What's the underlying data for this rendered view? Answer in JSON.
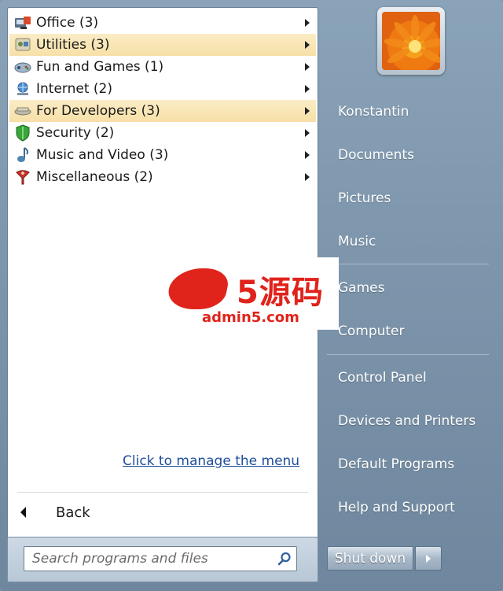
{
  "menu": {
    "items": [
      {
        "label": "Office (3)",
        "icon": "office-icon",
        "highlight": false
      },
      {
        "label": "Utilities (3)",
        "icon": "utilities-icon",
        "highlight": true
      },
      {
        "label": "Fun and Games (1)",
        "icon": "games-controller-icon",
        "highlight": false
      },
      {
        "label": "Internet (2)",
        "icon": "internet-icon",
        "highlight": false
      },
      {
        "label": "For Developers (3)",
        "icon": "developer-icon",
        "highlight": true
      },
      {
        "label": "Security (2)",
        "icon": "shield-icon",
        "highlight": false
      },
      {
        "label": "Music and Video (3)",
        "icon": "music-note-icon",
        "highlight": false
      },
      {
        "label": "Miscellaneous (2)",
        "icon": "misc-icon",
        "highlight": false
      }
    ],
    "manage_link": "Click to manage the menu",
    "back_label": "Back"
  },
  "search": {
    "placeholder": "Search programs and files"
  },
  "right": {
    "user": "Konstantin",
    "documents": "Documents",
    "pictures": "Pictures",
    "music": "Music",
    "games": "Games",
    "computer": "Computer",
    "control_panel": "Control Panel",
    "devices_printers": "Devices and Printers",
    "default_programs": "Default Programs",
    "help_support": "Help and Support"
  },
  "shutdown": {
    "label": "Shut down"
  },
  "watermark": {
    "brand": "5源码",
    "site": "admin5.com"
  },
  "colors": {
    "highlight": "#f7e0a7",
    "right_panel": "#7f97ad",
    "link": "#1f4e99",
    "watermark": "#e0231b"
  }
}
